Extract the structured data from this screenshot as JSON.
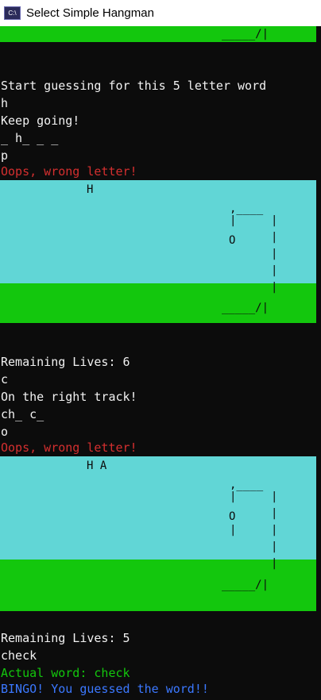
{
  "window": {
    "title": "Select Simple Hangman",
    "icon_text": "C:\\"
  },
  "scaffold": {
    "beam": ",____",
    "post": "|",
    "base": "_____/|"
  },
  "console": [
    "Start guessing for this 5 letter word",
    "h",
    "Keep going!",
    "_ h_ _ _",
    "p",
    "Oops, wrong letter!",
    "Remaining Lives: 6",
    "c",
    "On the right track!",
    "ch_ c_",
    "o",
    "Oops, wrong letter!",
    "Remaining Lives: 5",
    "check",
    "Actual word: check",
    "BINGO! You guessed the word!!"
  ],
  "panels": [
    {
      "wrong_letters": "H",
      "head": "O",
      "body": ""
    },
    {
      "wrong_letters": "H A",
      "head": "O",
      "body": "|"
    }
  ],
  "colors": {
    "sky": "#61d6d6",
    "grass": "#13c70d",
    "console_bg": "#0c0c0c",
    "error_text": "#d42f2f",
    "success_text": "#3b78ff",
    "info_text": "#13c70d"
  }
}
